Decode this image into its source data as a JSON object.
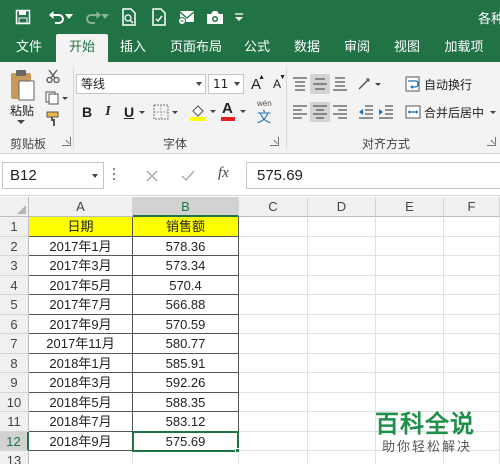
{
  "window": {
    "title_fragment": "各种"
  },
  "ribbon_tabs": [
    "文件",
    "开始",
    "插入",
    "页面布局",
    "公式",
    "数据",
    "审阅",
    "视图",
    "加载项"
  ],
  "active_tab": "开始",
  "clipboard": {
    "paste_label": "粘贴",
    "group_label": "剪贴板"
  },
  "font": {
    "name": "等线",
    "size": "11",
    "bold": "B",
    "italic": "I",
    "underline": "U",
    "grow": "A",
    "shrink": "A",
    "font_color_letter": "A",
    "phonetic": "文",
    "group_label": "字体"
  },
  "alignment": {
    "wrap_text_label": "自动换行",
    "merge_center_label": "合并后居中",
    "group_label": "对齐方式"
  },
  "formula_bar": {
    "name_box": "B12",
    "fx_label": "fx",
    "value": "575.69"
  },
  "grid": {
    "columns": [
      "A",
      "B",
      "C",
      "D",
      "E",
      "F"
    ],
    "rows": [
      "1",
      "2",
      "3",
      "4",
      "5",
      "6",
      "7",
      "8",
      "9",
      "10",
      "11",
      "12",
      "13"
    ],
    "header": [
      "日期",
      "销售额"
    ],
    "data": [
      [
        "2017年1月",
        "578.36"
      ],
      [
        "2017年3月",
        "573.34"
      ],
      [
        "2017年5月",
        "570.4"
      ],
      [
        "2017年7月",
        "566.88"
      ],
      [
        "2017年9月",
        "570.59"
      ],
      [
        "2017年11月",
        "580.77"
      ],
      [
        "2018年1月",
        "585.91"
      ],
      [
        "2018年3月",
        "592.26"
      ],
      [
        "2018年5月",
        "588.35"
      ],
      [
        "2018年7月",
        "583.12"
      ],
      [
        "2018年9月",
        "575.69"
      ]
    ],
    "selected_cell": "B12"
  },
  "watermark": {
    "title": "百科全说",
    "subtitle": "助你轻松解决"
  },
  "colors": {
    "excel_green": "#217346",
    "header_fill": "#ffff00",
    "watermark_green": "#1f8f4a"
  },
  "icons": [
    "save-icon",
    "undo-icon",
    "redo-icon",
    "print-preview-icon",
    "quick-print-icon",
    "email-icon",
    "camera-icon",
    "qat-dropdown-icon"
  ]
}
